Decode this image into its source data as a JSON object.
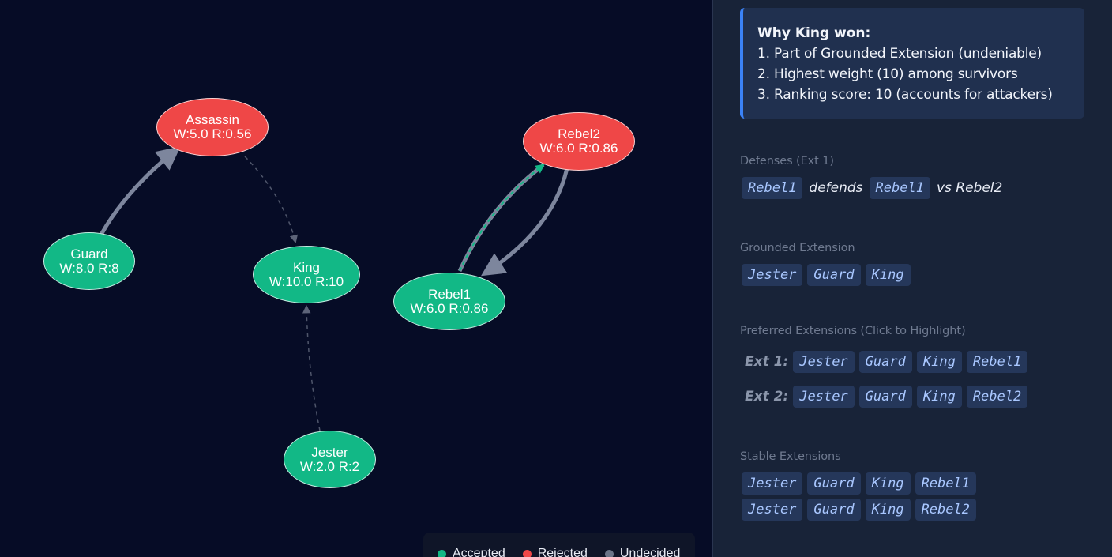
{
  "graph": {
    "nodes": {
      "assassin": {
        "name": "Assassin",
        "meta": "W:5.0 R:0.56",
        "status": "rejected"
      },
      "guard": {
        "name": "Guard",
        "meta": "W:8.0 R:8",
        "status": "accepted"
      },
      "king": {
        "name": "King",
        "meta": "W:10.0 R:10",
        "status": "accepted"
      },
      "jester": {
        "name": "Jester",
        "meta": "W:2.0 R:2",
        "status": "accepted"
      },
      "rebel1": {
        "name": "Rebel1",
        "meta": "W:6.0 R:0.86",
        "status": "accepted"
      },
      "rebel2": {
        "name": "Rebel2",
        "meta": "W:6.0 R:0.86",
        "status": "rejected"
      }
    },
    "edges": [
      {
        "from": "guard",
        "to": "assassin",
        "style": "solid"
      },
      {
        "from": "assassin",
        "to": "king",
        "style": "dashed"
      },
      {
        "from": "jester",
        "to": "king",
        "style": "dashed"
      },
      {
        "from": "rebel1",
        "to": "rebel2",
        "style": "solid",
        "highlight": true
      },
      {
        "from": "rebel2",
        "to": "rebel1",
        "style": "solid"
      }
    ]
  },
  "legend": {
    "items": [
      {
        "label": "Accepted",
        "color": "#12b886"
      },
      {
        "label": "Rejected",
        "color": "#ef4747"
      },
      {
        "label": "Undecided",
        "color": "#6b7488"
      }
    ]
  },
  "panel": {
    "why": {
      "title": "Why King won:",
      "lines": [
        "1. Part of Grounded Extension (undeniable)",
        "2. Highest weight (10) among survivors",
        "3. Ranking score: 10 (accounts for attackers)"
      ]
    },
    "defenses": {
      "label": "Defenses (Ext 1)",
      "defender": "Rebel1",
      "verb": "defends",
      "defended": "Rebel1",
      "against": "vs Rebel2"
    },
    "grounded": {
      "label": "Grounded Extension",
      "members": [
        "Jester",
        "Guard",
        "King"
      ]
    },
    "preferred": {
      "label": "Preferred Extensions (Click to Highlight)",
      "extensions": [
        {
          "label": "Ext 1:",
          "members": [
            "Jester",
            "Guard",
            "King",
            "Rebel1"
          ]
        },
        {
          "label": "Ext 2:",
          "members": [
            "Jester",
            "Guard",
            "King",
            "Rebel2"
          ]
        }
      ]
    },
    "stable": {
      "label": "Stable Extensions",
      "extensions": [
        {
          "members": [
            "Jester",
            "Guard",
            "King",
            "Rebel1"
          ]
        },
        {
          "members": [
            "Jester",
            "Guard",
            "King",
            "Rebel2"
          ]
        }
      ]
    }
  }
}
